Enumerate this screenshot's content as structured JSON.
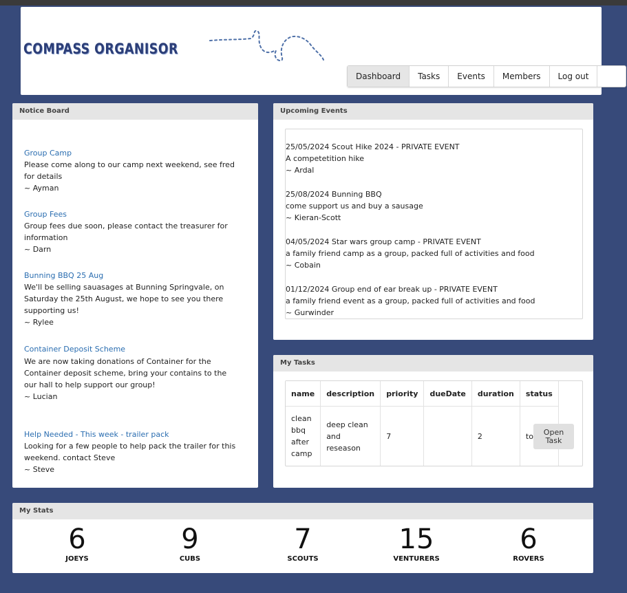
{
  "app": {
    "logo": "COMPASS ORGANISOR"
  },
  "nav": {
    "items": [
      "Dashboard",
      "Tasks",
      "Events",
      "Members",
      "Log out"
    ],
    "active": "Dashboard"
  },
  "notice_board": {
    "title": "Notice Board",
    "notices": [
      {
        "title": "Group Camp",
        "body": "Please come along to our camp next weekend, see fred for details",
        "author": "~ Ayman"
      },
      {
        "title": "Group Fees",
        "body": "Group fees due soon, please contact the treasurer for information",
        "author": "~ Darn"
      },
      {
        "title": "Bunning BBQ 25 Aug",
        "body": "We'll be selling sauasages at Bunning Springvale, on Saturday the 25th August, we hope to see you there supporting us!",
        "author": "~ Rylee"
      },
      {
        "title": "Container Deposit Scheme",
        "body": "We are now taking donations of Container for the Container deposit scheme, bring your contains to the our hall to help support our group!",
        "author": "~ Lucian"
      },
      {
        "title": "Help Needed - This week - trailer pack",
        "body": "Looking for a few people to help pack the trailer for this weekend. contact Steve",
        "author": "~ Steve"
      }
    ]
  },
  "upcoming_events": {
    "title": "Upcoming Events",
    "events": [
      {
        "heading": "25/05/2024 Scout Hike 2024 - PRIVATE EVENT",
        "desc": "A competetition hike",
        "author": "~ Ardal"
      },
      {
        "heading": "25/08/2024 Bunning BBQ",
        "desc": "come support us and buy a sausage",
        "author": "~ Kieran-Scott"
      },
      {
        "heading": "04/05/2024 Star wars group camp - PRIVATE EVENT",
        "desc": "a family friend camp as a group, packed full of activities and food",
        "author": "~ Cobain"
      },
      {
        "heading": "01/12/2024 Group end of ear break up - PRIVATE EVENT",
        "desc": "a family friend event as a group, packed full of activities and food",
        "author": "~ Gurwinder"
      }
    ]
  },
  "my_tasks": {
    "title": "My Tasks",
    "columns": [
      "name",
      "description",
      "priority",
      "dueDate",
      "duration",
      "status"
    ],
    "rows": [
      {
        "name": "clean bbq after camp",
        "description": "deep clean and reseason",
        "priority": "7",
        "dueDate": "",
        "duration": "2",
        "status": "toDo"
      }
    ],
    "open_button": "Open Task"
  },
  "my_stats": {
    "title": "My Stats",
    "stats": [
      {
        "value": "6",
        "label": "JOEYS"
      },
      {
        "value": "9",
        "label": "CUBS"
      },
      {
        "value": "7",
        "label": "SCOUTS"
      },
      {
        "value": "15",
        "label": "VENTURERS"
      },
      {
        "value": "6",
        "label": "ROVERS"
      }
    ]
  },
  "colors": {
    "background": "#374a7a",
    "logo": "#2c3e77",
    "link": "#2a6db0"
  }
}
